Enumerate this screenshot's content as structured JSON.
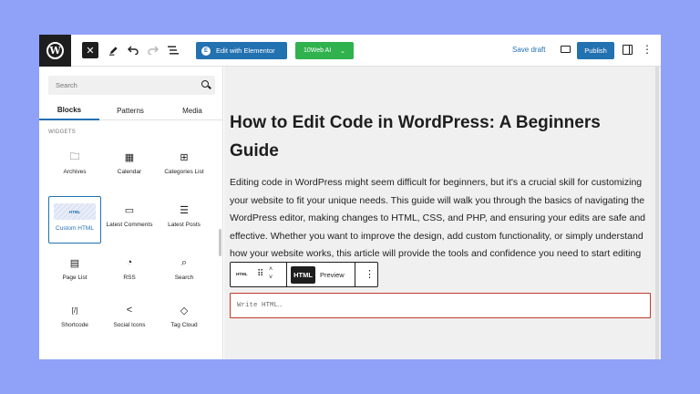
{
  "topbar": {
    "logo_letter": "W",
    "close_glyph": "✕",
    "elementor_badge": "E",
    "elementor_label": "Edit with Elementor",
    "tenweb_label": "10Web AI",
    "tenweb_chevron": "⌄",
    "save_draft_label": "Save draft",
    "publish_label": "Publish",
    "more_glyph": "⋮"
  },
  "inserter": {
    "search_placeholder": "Search",
    "tabs": [
      "Blocks",
      "Patterns",
      "Media"
    ],
    "active_tab": "Blocks",
    "section_label": "WIDGETS",
    "blocks": [
      {
        "label": "Archives",
        "icon": "archive-icon",
        "glyph": "🗀"
      },
      {
        "label": "Calendar",
        "icon": "calendar-icon",
        "glyph": "▦"
      },
      {
        "label": "Categories List",
        "icon": "categories-icon",
        "glyph": "⊞"
      },
      {
        "label": "Custom HTML",
        "icon": "html-icon",
        "glyph": "HTML",
        "selected": true
      },
      {
        "label": "Latest Comments",
        "icon": "comment-icon",
        "glyph": "▭"
      },
      {
        "label": "Latest Posts",
        "icon": "posts-list-icon",
        "glyph": "☰"
      },
      {
        "label": "Page List",
        "icon": "page-list-icon",
        "glyph": "▤"
      },
      {
        "label": "RSS",
        "icon": "rss-icon",
        "glyph": "◔"
      },
      {
        "label": "Search",
        "icon": "search-icon",
        "glyph": "⌕"
      },
      {
        "label": "Shortcode",
        "icon": "shortcode-icon",
        "glyph": "[/]"
      },
      {
        "label": "Social Icons",
        "icon": "share-icon",
        "glyph": "<"
      },
      {
        "label": "Tag Cloud",
        "icon": "tag-icon",
        "glyph": "◇"
      }
    ]
  },
  "post": {
    "title": "How to Edit Code in WordPress: A Beginners Guide",
    "body": "Editing code in WordPress might seem difficult for beginners, but it's a crucial skill for customizing your website to fit your unique needs. This guide will walk you through the basics of navigating the WordPress editor, making changes to HTML, CSS, and PHP, and ensuring your edits are safe and effective. Whether you want to improve the design, add custom functionality, or simply understand how your website works, this article will provide the tools and confidence you need to start editing"
  },
  "block_toolbar": {
    "block_icon_label": "HTML",
    "html_tab": "HTML",
    "preview_tab": "Preview",
    "active_tab": "HTML"
  },
  "html_block": {
    "placeholder": "Write HTML…",
    "value": ""
  },
  "colors": {
    "background": "#8fa2f7",
    "primary_blue": "#2271b1",
    "tenweb_green": "#30b24e",
    "editor_border_red": "#c0392b",
    "dark": "#1e1e1e"
  }
}
